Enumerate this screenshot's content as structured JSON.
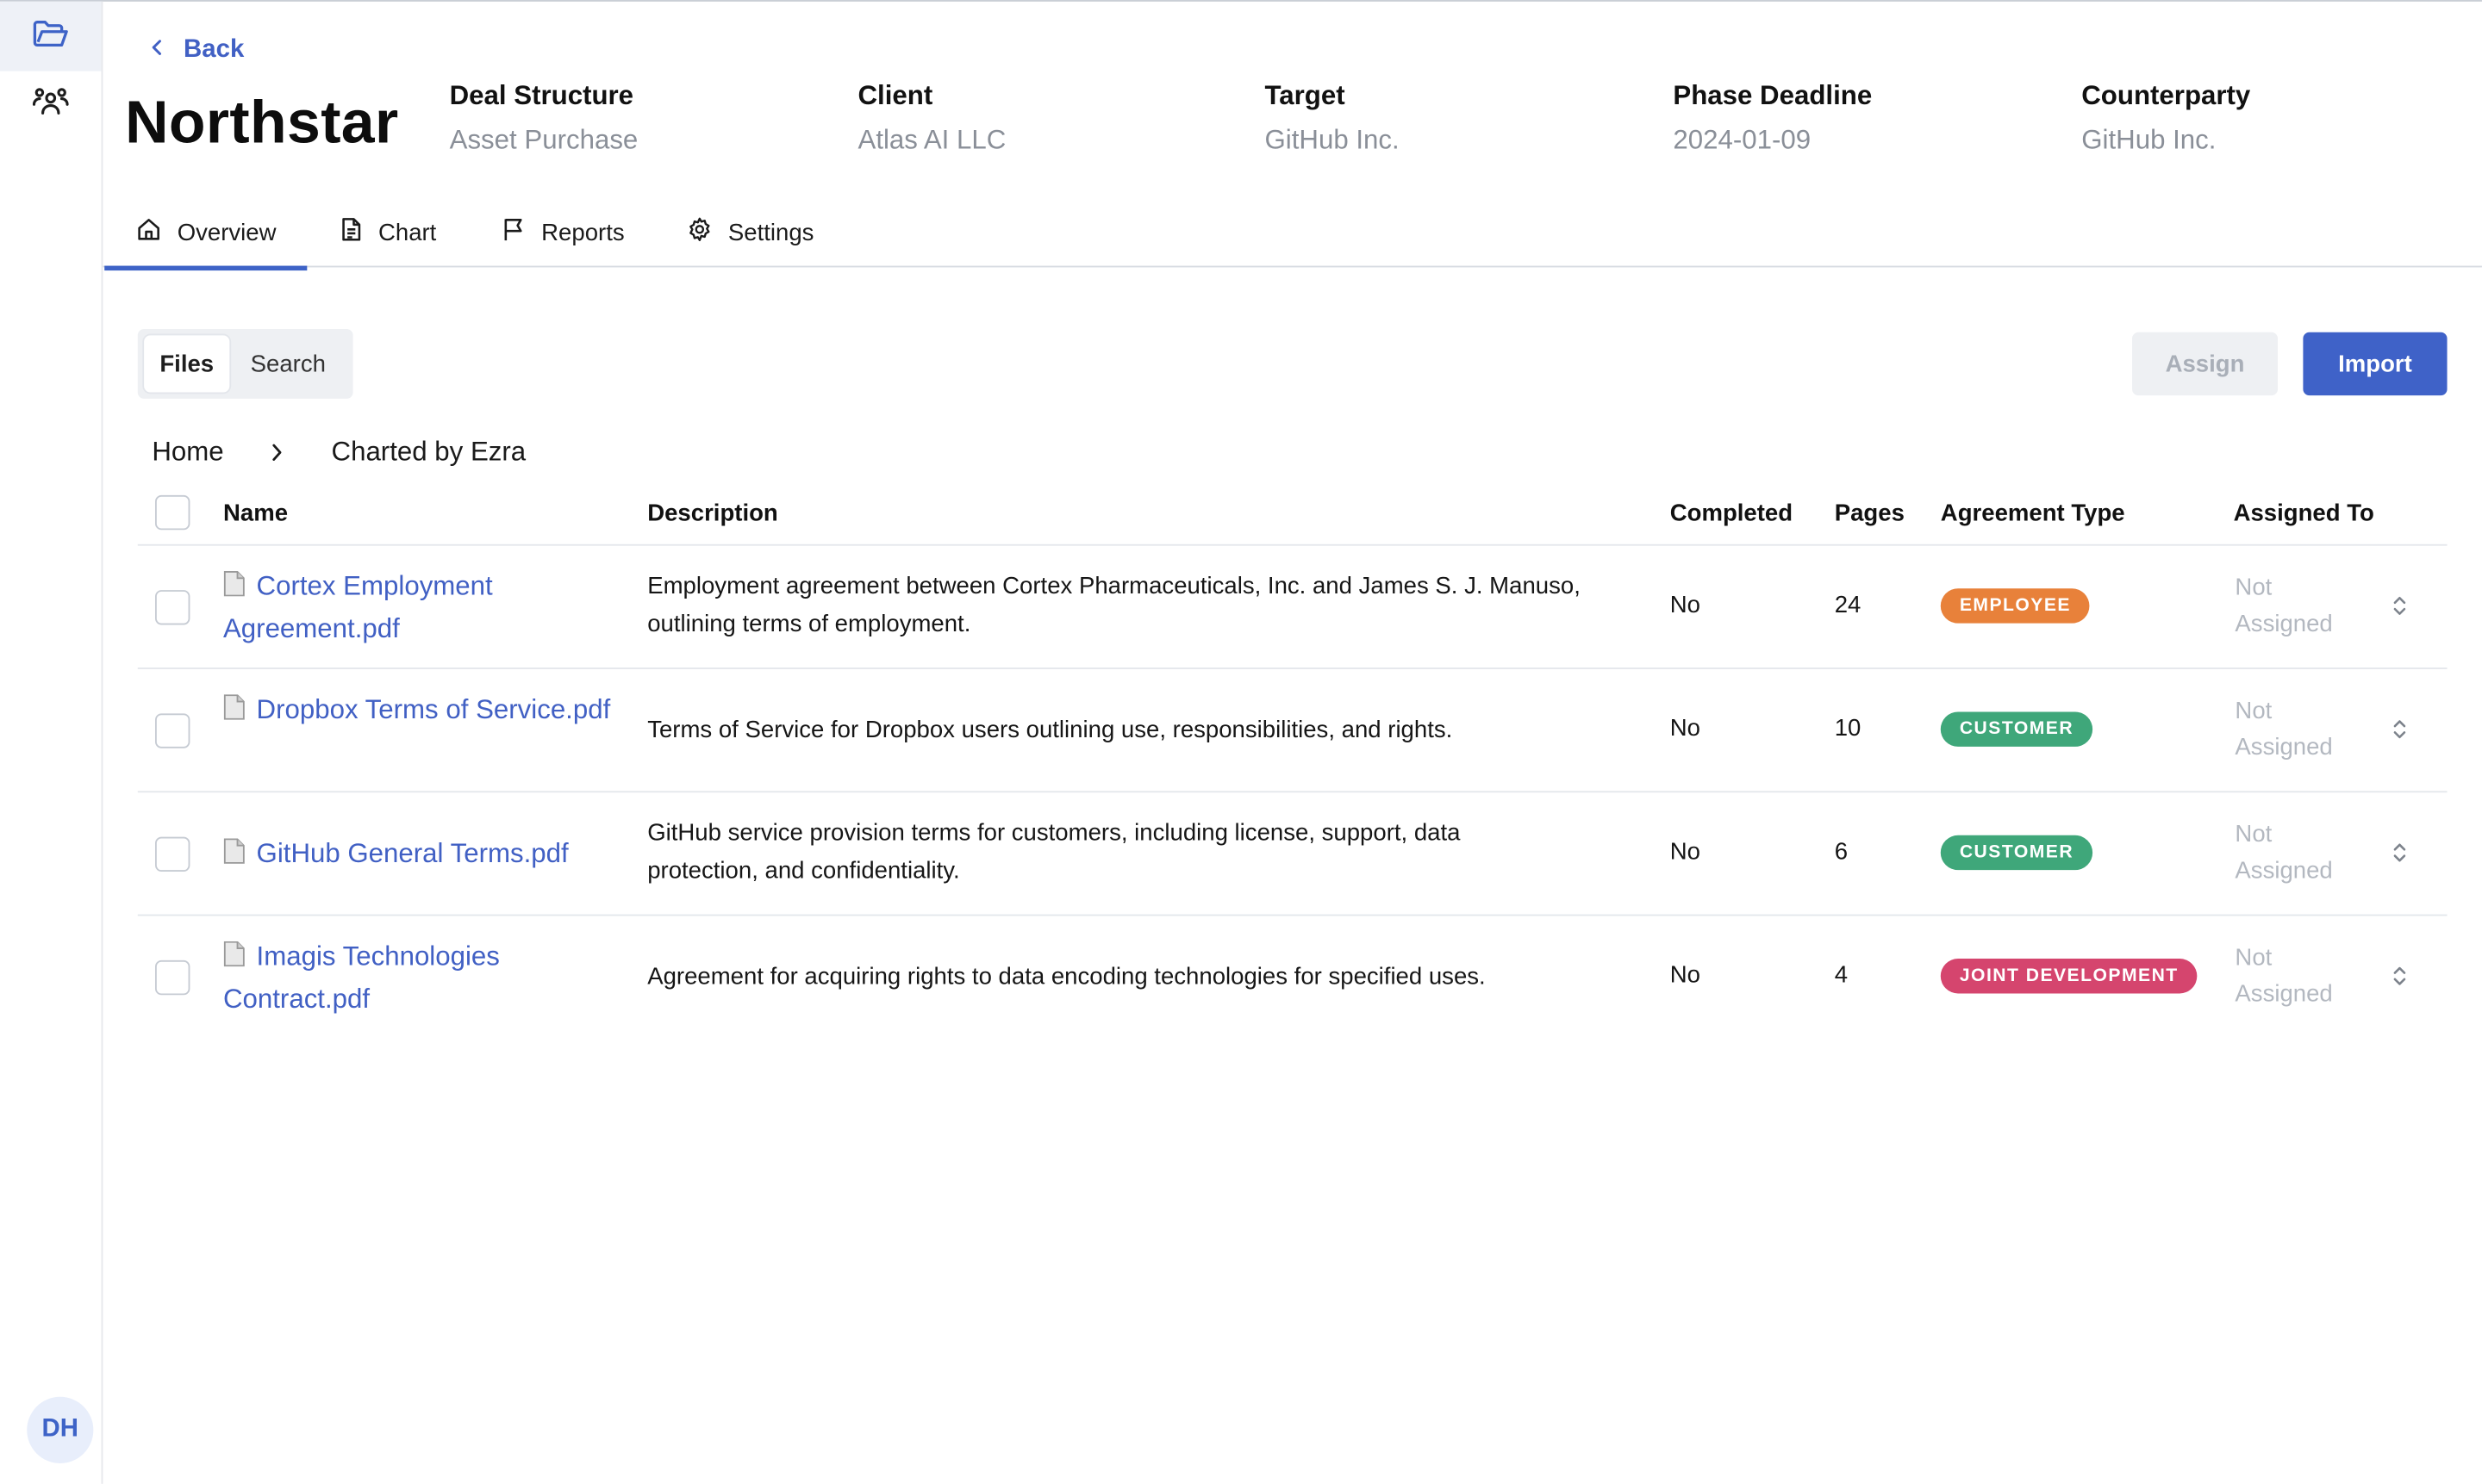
{
  "nav": {
    "back_label": "Back",
    "avatar_initials": "DH"
  },
  "project": {
    "title": "Northstar",
    "meta": [
      {
        "key": "Deal Structure",
        "value": "Asset Purchase"
      },
      {
        "key": "Client",
        "value": "Atlas AI LLC"
      },
      {
        "key": "Target",
        "value": "GitHub Inc."
      },
      {
        "key": "Phase Deadline",
        "value": "2024-01-09"
      },
      {
        "key": "Counterparty",
        "value": "GitHub Inc."
      }
    ]
  },
  "tabs": [
    {
      "label": "Overview",
      "icon": "home-icon",
      "active": true
    },
    {
      "label": "Chart",
      "icon": "document-icon",
      "active": false
    },
    {
      "label": "Reports",
      "icon": "flag-icon",
      "active": false
    },
    {
      "label": "Settings",
      "icon": "gear-icon",
      "active": false
    }
  ],
  "view_toggle": {
    "files_label": "Files",
    "search_label": "Search",
    "selected": "Files"
  },
  "actions": {
    "assign_label": "Assign",
    "import_label": "Import"
  },
  "breadcrumb": {
    "home": "Home",
    "current": "Charted by Ezra"
  },
  "table": {
    "columns": [
      "Name",
      "Description",
      "Completed",
      "Pages",
      "Agreement Type",
      "Assigned To"
    ],
    "rows": [
      {
        "name": "Cortex Employment Agreement.pdf",
        "description": "Employment agreement between Cortex Pharmaceuticals, Inc. and James S. J. Manuso, outlining terms of employment.",
        "completed": "No",
        "pages": "24",
        "agreement_type": "EMPLOYEE",
        "assigned_to": "Not Assigned"
      },
      {
        "name": "Dropbox Terms of Service.pdf",
        "description": "Terms of Service for Dropbox users outlining use, responsibilities, and rights.",
        "completed": "No",
        "pages": "10",
        "agreement_type": "CUSTOMER",
        "assigned_to": "Not Assigned"
      },
      {
        "name": "GitHub General Terms.pdf",
        "description": "GitHub service provision terms for customers, including license, support, data protection, and confidentiality.",
        "completed": "No",
        "pages": "6",
        "agreement_type": "CUSTOMER",
        "assigned_to": "Not Assigned"
      },
      {
        "name": "Imagis Technologies Contract.pdf",
        "description": "Agreement for acquiring rights to data encoding technologies for specified uses.",
        "completed": "No",
        "pages": "4",
        "agreement_type": "JOINT DEVELOPMENT",
        "assigned_to": "Not Assigned"
      }
    ]
  },
  "colors": {
    "accent": "#3f62c8",
    "badge_employee": "#e8813a",
    "badge_customer": "#3fa77a",
    "badge_joint_development": "#d5456e"
  }
}
